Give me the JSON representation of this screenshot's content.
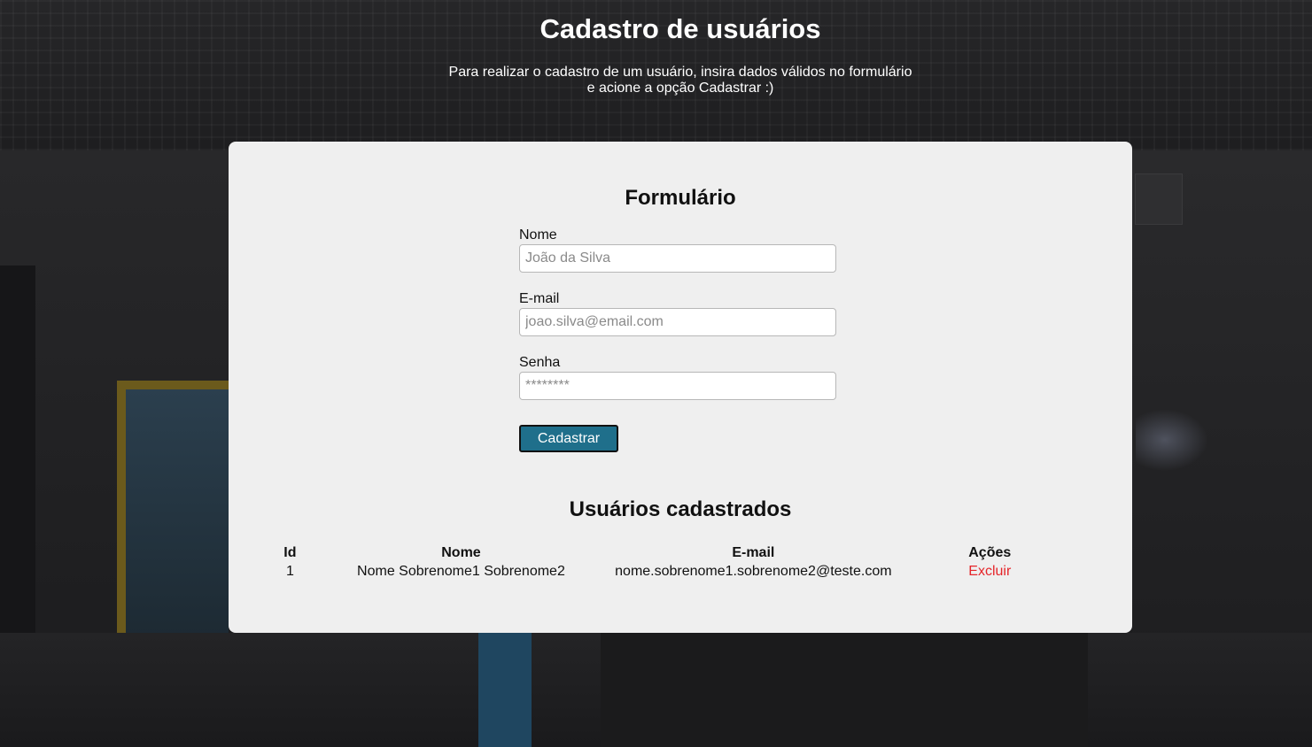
{
  "page": {
    "title": "Cadastro de usuários",
    "subtitle_line1": "Para realizar o cadastro de um usuário, insira dados válidos no formulário",
    "subtitle_line2": "e acione a opção Cadastrar :)"
  },
  "form": {
    "title": "Formulário",
    "fields": [
      {
        "label": "Nome",
        "placeholder": "João da Silva",
        "type": "text"
      },
      {
        "label": "E-mail",
        "placeholder": "joao.silva@email.com",
        "type": "email"
      },
      {
        "label": "Senha",
        "placeholder": "********",
        "type": "password"
      }
    ],
    "submit_label": "Cadastrar"
  },
  "users": {
    "title": "Usuários cadastrados",
    "columns": [
      "Id",
      "Nome",
      "E-mail",
      "Ações"
    ],
    "rows": [
      {
        "id": "1",
        "nome": "Nome Sobrenome1 Sobrenome2",
        "email": "nome.sobrenome1.sobrenome2@teste.com",
        "action": "Excluir"
      }
    ]
  },
  "colors": {
    "card_background": "#efefef",
    "button_background": "#1f6f8b",
    "delete_link": "#e5252a",
    "header_text": "#ffffff"
  }
}
